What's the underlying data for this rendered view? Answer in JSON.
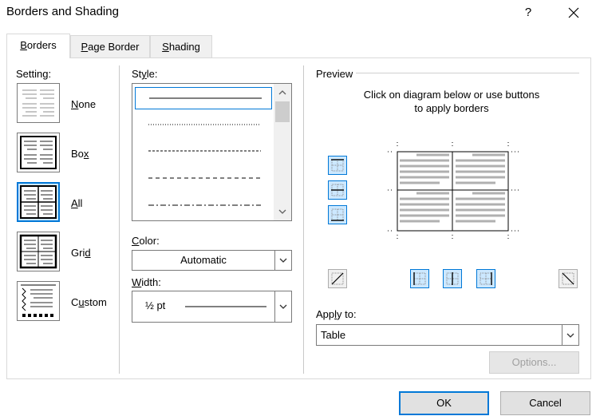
{
  "window": {
    "title": "Borders and Shading",
    "help": "?"
  },
  "tabs": [
    {
      "label": "Borders",
      "mnemonic": "B",
      "rest": "orders"
    },
    {
      "label": "Page Border",
      "mnemonic": "P",
      "rest": "age Border"
    },
    {
      "label": "Shading",
      "mnemonic": "S",
      "rest": "hading"
    }
  ],
  "setting": {
    "label": "Setting:",
    "items": [
      {
        "pre": "",
        "mn": "N",
        "post": "one"
      },
      {
        "pre": "Bo",
        "mn": "x",
        "post": ""
      },
      {
        "pre": "",
        "mn": "A",
        "post": "ll"
      },
      {
        "pre": "Gri",
        "mn": "d",
        "post": ""
      },
      {
        "pre": "C",
        "mn": "u",
        "post": "stom"
      }
    ],
    "selected": "All"
  },
  "style": {
    "label_pre": "St",
    "label_mn": "y",
    "label_post": "le:"
  },
  "color": {
    "label_pre": "",
    "label_mn": "C",
    "label_post": "olor:",
    "value": "Automatic"
  },
  "width": {
    "label_pre": "",
    "label_mn": "W",
    "label_post": "idth:",
    "value": "½ pt"
  },
  "preview": {
    "label": "Preview",
    "instruction_line1": "Click on diagram below or use buttons",
    "instruction_line2": "to apply borders"
  },
  "apply_to": {
    "label_pre": "App",
    "label_mn": "l",
    "label_post": "y to:",
    "value": "Table"
  },
  "buttons": {
    "options": "Options...",
    "ok": "OK",
    "cancel": "Cancel"
  },
  "colors": {
    "accent": "#0078d7",
    "selected_fill": "#cce8ff"
  }
}
